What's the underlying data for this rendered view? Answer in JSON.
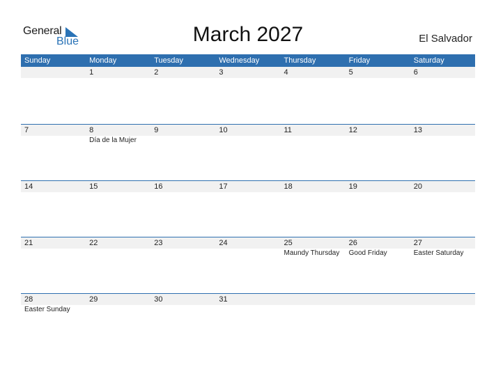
{
  "logo": {
    "general": "General",
    "blue": "Blue"
  },
  "header": {
    "title": "March 2027",
    "country": "El Salvador"
  },
  "calendar": {
    "weekdays": [
      "Sunday",
      "Monday",
      "Tuesday",
      "Wednesday",
      "Thursday",
      "Friday",
      "Saturday"
    ],
    "weeks": [
      [
        {
          "day": "",
          "holiday": ""
        },
        {
          "day": "1",
          "holiday": ""
        },
        {
          "day": "2",
          "holiday": ""
        },
        {
          "day": "3",
          "holiday": ""
        },
        {
          "day": "4",
          "holiday": ""
        },
        {
          "day": "5",
          "holiday": ""
        },
        {
          "day": "6",
          "holiday": ""
        }
      ],
      [
        {
          "day": "7",
          "holiday": ""
        },
        {
          "day": "8",
          "holiday": "Día de la Mujer"
        },
        {
          "day": "9",
          "holiday": ""
        },
        {
          "day": "10",
          "holiday": ""
        },
        {
          "day": "11",
          "holiday": ""
        },
        {
          "day": "12",
          "holiday": ""
        },
        {
          "day": "13",
          "holiday": ""
        }
      ],
      [
        {
          "day": "14",
          "holiday": ""
        },
        {
          "day": "15",
          "holiday": ""
        },
        {
          "day": "16",
          "holiday": ""
        },
        {
          "day": "17",
          "holiday": ""
        },
        {
          "day": "18",
          "holiday": ""
        },
        {
          "day": "19",
          "holiday": ""
        },
        {
          "day": "20",
          "holiday": ""
        }
      ],
      [
        {
          "day": "21",
          "holiday": ""
        },
        {
          "day": "22",
          "holiday": ""
        },
        {
          "day": "23",
          "holiday": ""
        },
        {
          "day": "24",
          "holiday": ""
        },
        {
          "day": "25",
          "holiday": "Maundy Thursday"
        },
        {
          "day": "26",
          "holiday": "Good Friday"
        },
        {
          "day": "27",
          "holiday": "Easter Saturday"
        }
      ],
      [
        {
          "day": "28",
          "holiday": "Easter Sunday"
        },
        {
          "day": "29",
          "holiday": ""
        },
        {
          "day": "30",
          "holiday": ""
        },
        {
          "day": "31",
          "holiday": ""
        },
        {
          "day": "",
          "holiday": ""
        },
        {
          "day": "",
          "holiday": ""
        },
        {
          "day": "",
          "holiday": ""
        }
      ]
    ]
  },
  "colors": {
    "accent": "#2e6faf",
    "logo_blue": "#2a73b7",
    "date_strip": "#f1f1f1"
  }
}
